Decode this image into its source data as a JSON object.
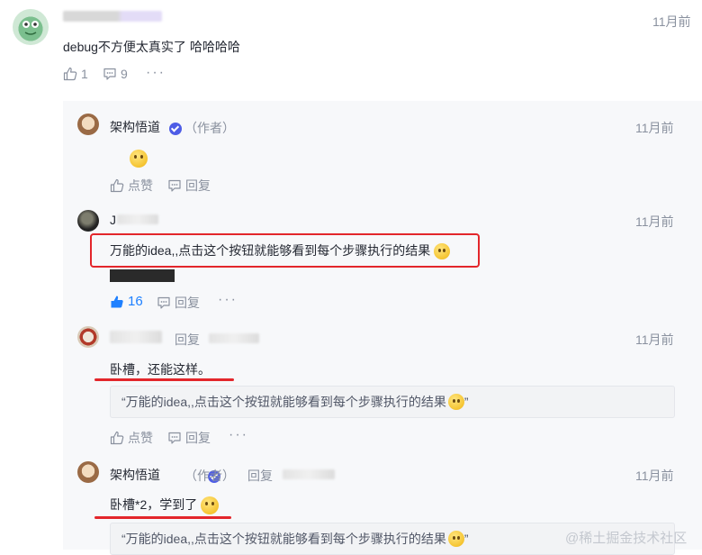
{
  "main_comment": {
    "time": "11月前",
    "text": "debug不方便太真实了 哈哈哈哈",
    "like_count": "1",
    "reply_count": "9",
    "more": "···"
  },
  "replies": [
    {
      "author": "架构悟道",
      "badge": "（作者）",
      "time": "11月前",
      "like_label": "点赞",
      "reply_label": "回复"
    },
    {
      "author_initial": "J",
      "time": "11月前",
      "text": "万能的idea,,点击这个按钮就能够看到每个步骤执行的结果",
      "like_count": "16",
      "reply_label": "回复",
      "more": "···"
    },
    {
      "reply_word": "回复",
      "time": "11月前",
      "text": "卧槽，还能这样。",
      "quote": "“万能的idea,,点击这个按钮就能够看到每个步骤执行的结果",
      "quote_end": "”",
      "like_label": "点赞",
      "reply_label": "回复",
      "more": "···"
    },
    {
      "author": "架构悟道",
      "badge": "（作者）",
      "reply_word": "回复",
      "time": "11月前",
      "text": "卧槽*2，学到了",
      "quote": "“万能的idea,,点击这个按钮就能够看到每个步骤执行的结果",
      "quote_end": "”"
    }
  ],
  "watermark": "@稀土掘金技术社区",
  "colors": {
    "accent_blue": "#1e80ff",
    "highlight_red": "#e3262b",
    "muted": "#8a919f",
    "panel_bg": "#f7f8fa"
  }
}
